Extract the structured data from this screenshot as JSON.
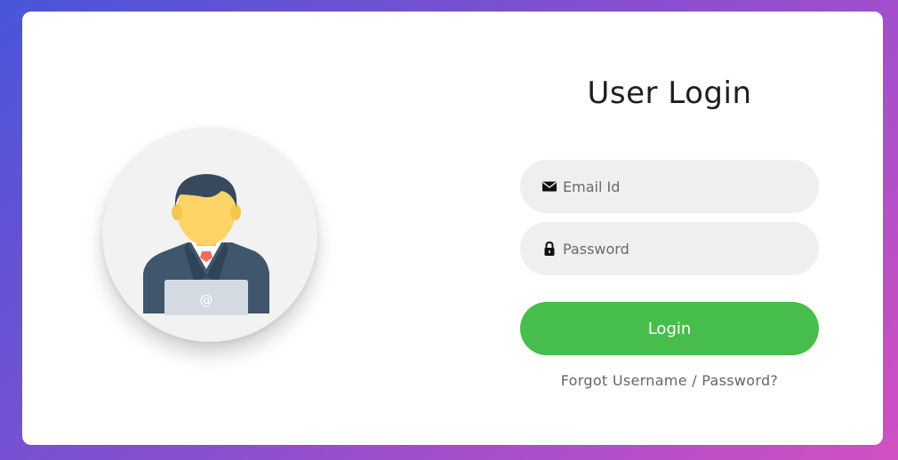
{
  "login": {
    "title": "User Login",
    "email": {
      "placeholder": "Email Id",
      "value": "",
      "icon": "envelope-icon"
    },
    "password": {
      "placeholder": "Password",
      "value": "",
      "icon": "lock-icon"
    },
    "button_label": "Login",
    "forgot_link": "Forgot Username / Password?"
  },
  "avatar": {
    "icon": "user-avatar-icon",
    "laptop_symbol": "@"
  },
  "colors": {
    "background_start": "#4a55d8",
    "background_end": "#d24fc4",
    "button": "#47bd4b",
    "field_bg": "#efefef"
  }
}
